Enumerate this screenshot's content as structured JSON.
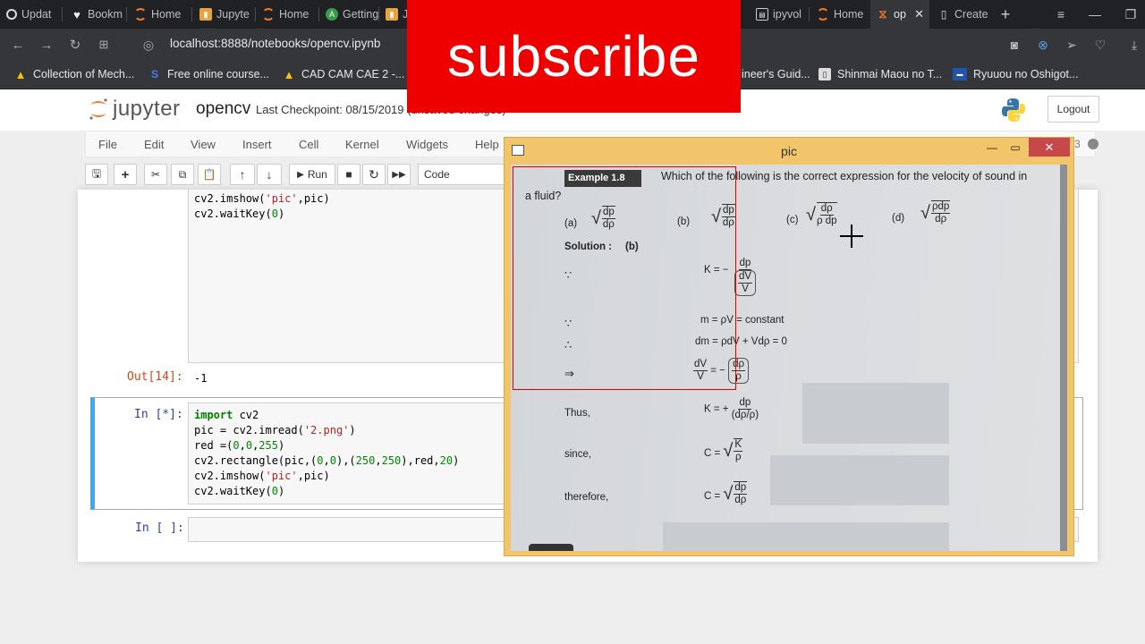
{
  "browser": {
    "tabs": [
      {
        "label": "Updat"
      },
      {
        "label": "Bookm"
      },
      {
        "label": "Home"
      },
      {
        "label": "Jupyte"
      },
      {
        "label": "Home"
      },
      {
        "label": "Getting"
      },
      {
        "label": "Ju"
      },
      {
        "label": "ipyvol"
      },
      {
        "label": "Home"
      },
      {
        "label": "op"
      },
      {
        "label": "Create"
      }
    ],
    "url": "localhost:8888/notebooks/opencv.ipynb",
    "bookmarks": [
      {
        "label": "Collection of Mech..."
      },
      {
        "label": "Free online course..."
      },
      {
        "label": "CAD CAM CAE 2 -..."
      },
      {
        "label": "ineer's Guid..."
      },
      {
        "label": "Shinmai Maou no T..."
      },
      {
        "label": "Ryuuou no Oshigot..."
      }
    ]
  },
  "banner": {
    "text": "subscribe"
  },
  "jupyter": {
    "logo_text": "jupyter",
    "notebook_name": "opencv",
    "checkpoint": "Last Checkpoint: 08/15/2019",
    "unsaved": "(unsaved changes)",
    "logout": "Logout",
    "kernel_num": "3",
    "menu": [
      "File",
      "Edit",
      "View",
      "Insert",
      "Cell",
      "Kernel",
      "Widgets",
      "Help"
    ],
    "toolbar": {
      "run": "Run",
      "cell_type": "Code"
    },
    "cells": {
      "cell1_lines": [
        "cv2.imshow('pic',pic)",
        "cv2.waitKey(0)"
      ],
      "out_prompt": "Out[14]:",
      "out_value": "-1",
      "cell2_prompt": "In [*]:",
      "cell2_lines": [
        "import cv2",
        "pic = cv2.imread('2.png')",
        "red =(0,0,255)",
        "cv2.rectangle(pic,(0,0),(250,250),red,20)",
        "cv2.imshow('pic',pic)",
        "cv2.waitKey(0)"
      ],
      "cell3_prompt": "In [ ]:"
    }
  },
  "cv_window": {
    "title": "pic",
    "image": {
      "example_tag": "Example 1.8",
      "question": "Which of the following is the correct expression for the velocity of sound in",
      "question_cont": "a fluid?",
      "options": {
        "a": "(a)",
        "b": "(b)",
        "c": "(c)",
        "d": "(d)"
      },
      "solution": "Solution :",
      "solution_ans": "(b)",
      "lines": {
        "because1": "∵",
        "k_eq": "K = −",
        "because2": "∵",
        "m_eq": "m = ρV = constant",
        "therefore": "∴",
        "dm_eq": "dm = ρdV + Vdρ = 0",
        "implies": "⇒",
        "thus": "Thus,",
        "since": "since,",
        "therefore_word": "therefore,"
      }
    }
  }
}
